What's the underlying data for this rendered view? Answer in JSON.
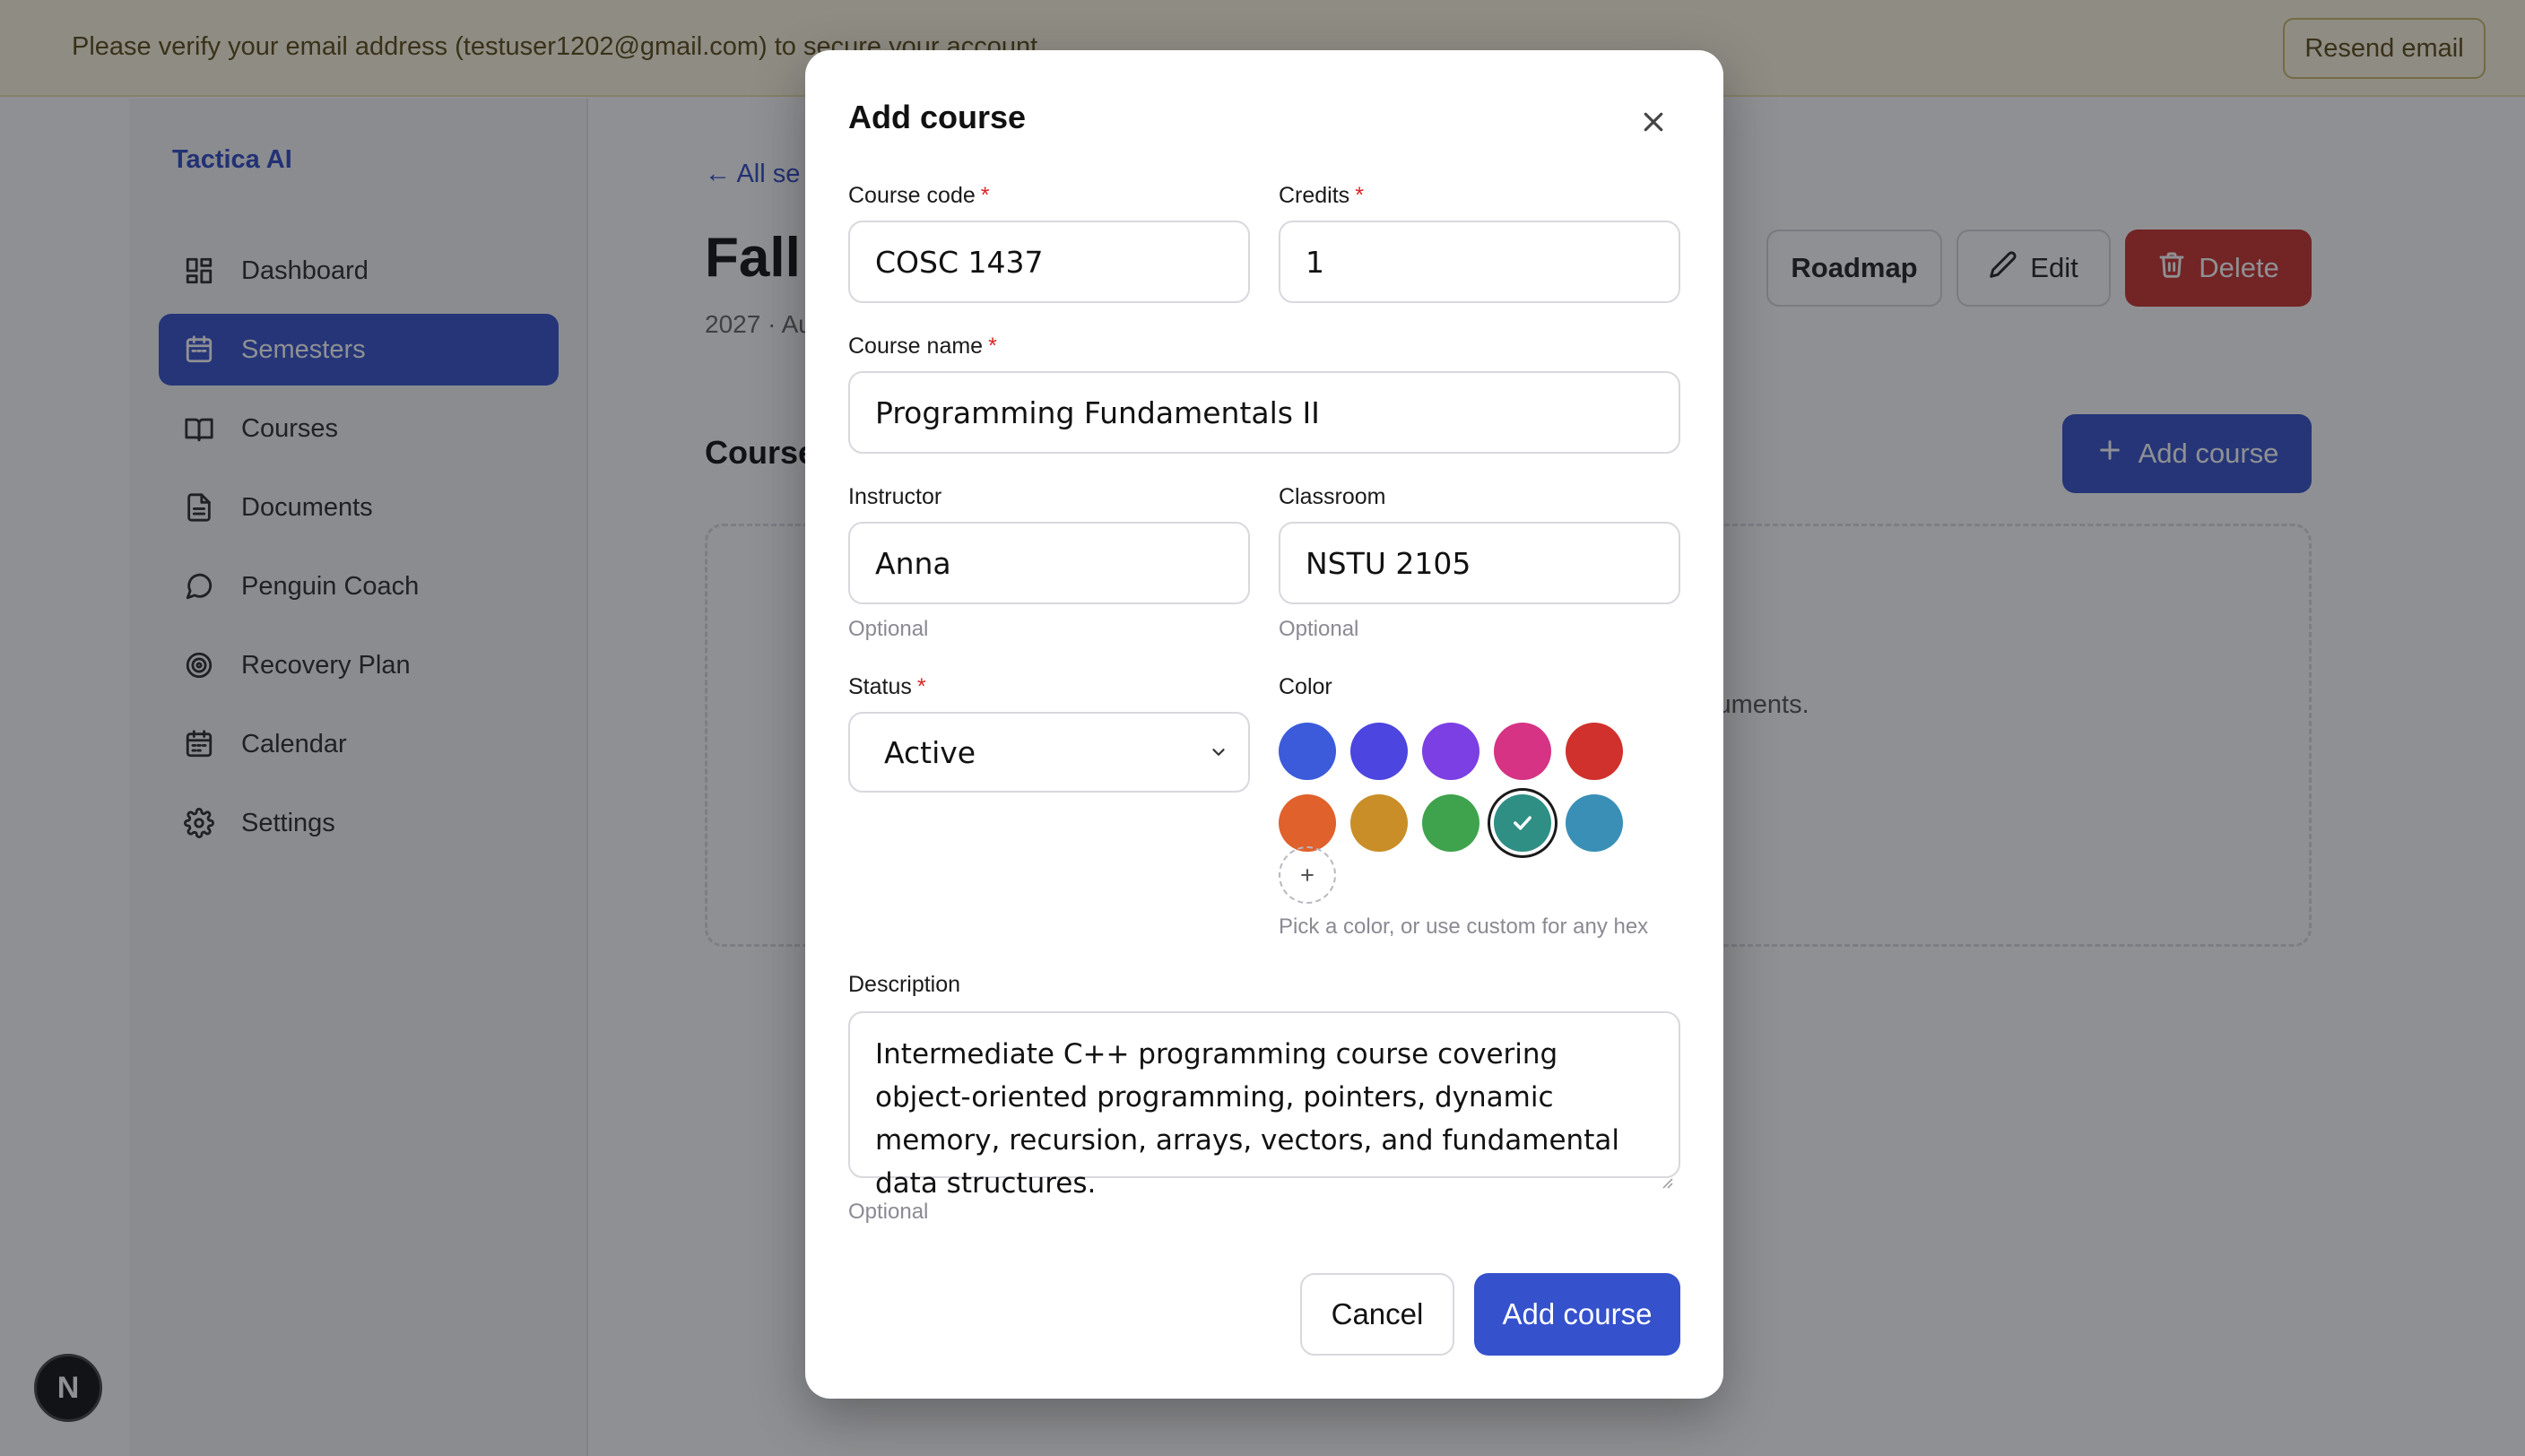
{
  "banner": {
    "message": "Please verify your email address (testuser1202@gmail.com) to secure your account.",
    "resend_label": "Resend email"
  },
  "sidebar": {
    "brand": "Tactica AI",
    "items": [
      {
        "label": "Dashboard",
        "icon": "dashboard-icon",
        "active": false
      },
      {
        "label": "Semesters",
        "icon": "calendar-icon",
        "active": true
      },
      {
        "label": "Courses",
        "icon": "book-icon",
        "active": false
      },
      {
        "label": "Documents",
        "icon": "document-icon",
        "active": false
      },
      {
        "label": "Penguin Coach",
        "icon": "chat-icon",
        "active": false
      },
      {
        "label": "Recovery Plan",
        "icon": "target-icon",
        "active": false
      },
      {
        "label": "Calendar",
        "icon": "calendar-icon",
        "active": false
      },
      {
        "label": "Settings",
        "icon": "gear-icon",
        "active": false
      }
    ]
  },
  "main": {
    "back_label": "All se",
    "title": "Fall",
    "subtitle": "2027 · Au",
    "section_title": "Course",
    "empty_text_fragment": "cuments.",
    "roadmap_label": "Roadmap",
    "edit_label": "Edit",
    "delete_label": "Delete",
    "add_course_label": "Add course"
  },
  "modal": {
    "title": "Add course",
    "course_code": {
      "label": "Course code",
      "value": "COSC 1437"
    },
    "credits": {
      "label": "Credits",
      "value": "1"
    },
    "course_name": {
      "label": "Course name",
      "value": "Programming Fundamentals II"
    },
    "instructor": {
      "label": "Instructor",
      "value": "Anna",
      "hint": "Optional"
    },
    "classroom": {
      "label": "Classroom",
      "value": "NSTU 2105",
      "hint": "Optional"
    },
    "status": {
      "label": "Status",
      "value": "Active"
    },
    "color": {
      "label": "Color",
      "swatches": [
        "#3b5bdb",
        "#4c45e0",
        "#7b3fe4",
        "#d63384",
        "#d0312d",
        "#e0612b",
        "#c98e28",
        "#3fa34d",
        "#2f8f84",
        "#3a8fb7"
      ],
      "selected_index": 8,
      "hint": "Pick a color, or use custom for any hex"
    },
    "description": {
      "label": "Description",
      "value": "Intermediate C++ programming course covering object-oriented programming, pointers, dynamic memory, recursion, arrays, vectors, and fundamental data structures.",
      "hint": "Optional"
    },
    "cancel_label": "Cancel",
    "submit_label": "Add course"
  },
  "next_badge": "N",
  "colors": {
    "accent": "#3551cc",
    "danger": "#c9302c",
    "banner_bg": "#fdf7e1"
  }
}
